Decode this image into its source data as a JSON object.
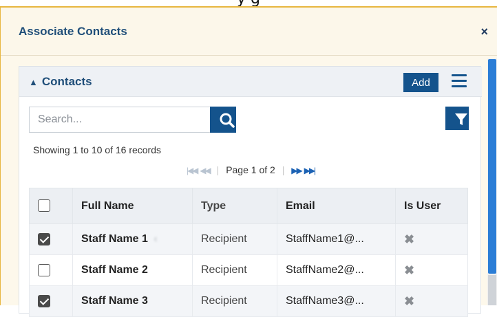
{
  "modal": {
    "title": "Associate Contacts",
    "close_label": "×"
  },
  "panel": {
    "title": "Contacts",
    "add_label": "Add"
  },
  "search": {
    "placeholder": "Search..."
  },
  "records_text": "Showing 1 to 10 of 16 records",
  "pager": {
    "text": "Page 1 of 2"
  },
  "table": {
    "headers": [
      "Full Name",
      "Type",
      "Email",
      "Is User"
    ],
    "rows": [
      {
        "checked": true,
        "name": "Staff Name 1",
        "type": "Recipient",
        "email": "StaffName1@...",
        "is_user": "✖"
      },
      {
        "checked": false,
        "name": "Staff Name 2",
        "type": "Recipient",
        "email": "StaffName2@...",
        "is_user": "✖"
      },
      {
        "checked": true,
        "name": "Staff Name 3",
        "type": "Recipient",
        "email": "StaffName3@...",
        "is_user": "✖"
      }
    ]
  },
  "colors": {
    "accent": "#14538c",
    "title": "#1f4e79",
    "modal_border": "#e7b63f",
    "scrollbar": "#2b7dd6"
  },
  "icons": [
    "close-icon",
    "caret-up-icon",
    "hamburger-menu-icon",
    "search-icon",
    "filter-icon",
    "first-page-icon",
    "prev-page-icon",
    "next-page-icon",
    "last-page-icon",
    "checkbox-icon",
    "x-mark-icon"
  ]
}
